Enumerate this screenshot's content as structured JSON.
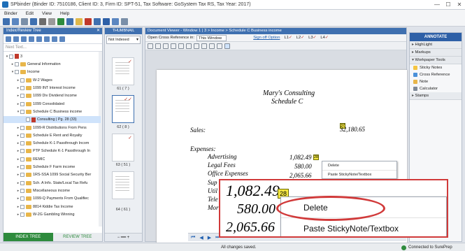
{
  "window": {
    "title": "SPbinder (Binder ID: 7510186, Client ID: 3, Firm ID: SPT-51, Tax Software: GoSystem Tax RS, Tax Year: 2017)",
    "controls": [
      "—",
      "☐",
      "✕"
    ]
  },
  "menu": [
    "Binder",
    "Edit",
    "View",
    "Help"
  ],
  "left_panel": {
    "header": "Index/Review Tree",
    "close": "✕",
    "search_placeholder": "Next Text...",
    "tree": [
      {
        "label": "3",
        "level": 0,
        "type": "doc",
        "exp": "▾"
      },
      {
        "label": "General Information",
        "level": 1,
        "type": "folder",
        "exp": "▸"
      },
      {
        "label": "Income",
        "level": 1,
        "type": "folder",
        "exp": "▾"
      },
      {
        "label": "W-2 Wages",
        "level": 2,
        "type": "folder",
        "exp": "▸"
      },
      {
        "label": "1099 INT Interest Income",
        "level": 2,
        "type": "folder",
        "exp": "▸"
      },
      {
        "label": "1099 Div Dividend Income",
        "level": 2,
        "type": "folder",
        "exp": "▸"
      },
      {
        "label": "1099 Consolidated",
        "level": 2,
        "type": "folder",
        "exp": "▸"
      },
      {
        "label": "Schedule C Business income",
        "level": 2,
        "type": "folder",
        "exp": "▾"
      },
      {
        "label": "Consulting | Pg. 28 (33)",
        "level": 3,
        "type": "doc",
        "exp": "",
        "selected": true
      },
      {
        "label": "1099-R  Distributions From Pens",
        "level": 2,
        "type": "folder",
        "exp": "▸"
      },
      {
        "label": "Schedule E  Rent and Royalty",
        "level": 2,
        "type": "folder",
        "exp": "▸"
      },
      {
        "label": "Schedule K-1 Passthrough Incom",
        "level": 2,
        "type": "folder",
        "exp": "▸"
      },
      {
        "label": "PTP Schedule K-1 Passthrough In",
        "level": 2,
        "type": "folder",
        "exp": "▸"
      },
      {
        "label": "REMIC",
        "level": 2,
        "type": "folder",
        "exp": "▸"
      },
      {
        "label": "Schedule F Farm income",
        "level": 2,
        "type": "folder",
        "exp": "▸"
      },
      {
        "label": "1RS-SSA 1099 Social Security Ber",
        "level": 2,
        "type": "folder",
        "exp": "▸"
      },
      {
        "label": "Sch. A Info. State/Local Tax Refu",
        "level": 2,
        "type": "folder",
        "exp": "▸"
      },
      {
        "label": "Miscellaneous income",
        "level": 2,
        "type": "folder",
        "exp": "▸"
      },
      {
        "label": "1099-Q Payments From Qualifiec",
        "level": 2,
        "type": "folder",
        "exp": "▸"
      },
      {
        "label": "8814 Kiddie Tax Income",
        "level": 2,
        "type": "folder",
        "exp": "▸"
      },
      {
        "label": "W-2G Gambling Winning",
        "level": 2,
        "type": "folder",
        "exp": "▸"
      }
    ],
    "tabs": [
      "INDEX TREE",
      "REVIEW TREE"
    ]
  },
  "thumbnails": {
    "tab": "THUMBNAIL",
    "filter": "Not Indexed",
    "pages": [
      {
        "caption": "61 ( 7 )",
        "check": "✓"
      },
      {
        "caption": "62 ( 8 )",
        "check": "✓✓"
      },
      {
        "caption": "63 ( 51 )",
        "check": "✓"
      },
      {
        "caption": "64 ( 61 )",
        "check": ""
      }
    ],
    "bottom": "− ━━ +"
  },
  "viewer": {
    "tab": "Document Viewer - Window 1 | 3 > Income > Schedule C Business income",
    "cross_ref_label": "Open Cross Reference in:",
    "cross_ref_value": "This Window",
    "signoff": "Sign off Option",
    "levels": [
      "L1",
      "L2",
      "L3",
      "L4"
    ],
    "page": {
      "title1": "Mary's Consulting",
      "title2": "Schedule C",
      "sales_label": "Sales:",
      "sales_value": "32,180.65",
      "sales_tag": "37",
      "expenses_label": "Expenses:",
      "expenses": [
        "Advertising",
        "Legal Fees",
        "Office Expenses",
        "Sup",
        "Util",
        "Tele",
        "Mor"
      ],
      "amounts": [
        "1,082.49",
        "580.00",
        "2,065.66"
      ],
      "amount_tag": "28"
    },
    "context_menu": [
      "Delete",
      "Paste StickyNote/Textbox"
    ],
    "nav": [
      "⏮",
      "◀",
      "▶",
      "⏭"
    ]
  },
  "right_panel": {
    "annotate": "ANNOTATE",
    "sections": [
      {
        "label": "HighLight",
        "open": false
      },
      {
        "label": "Markups",
        "open": false
      },
      {
        "label": "Workpaper Tools",
        "open": true
      }
    ],
    "tools": [
      {
        "label": "Sticky Notes",
        "color": "#f5c542"
      },
      {
        "label": "Cross Reference",
        "color": "#4a90d9"
      },
      {
        "label": "Note",
        "color": "#e8b64a"
      },
      {
        "label": "Calculator",
        "color": "#7f8a97"
      }
    ],
    "stamps": "Stamps"
  },
  "zoom": {
    "amounts": [
      "1,082.49",
      "580.00",
      "2,065.66"
    ],
    "tag": "28",
    "menu": [
      "Delete",
      "Paste StickyNote/Textbox"
    ]
  },
  "status": {
    "message": "All changes saved.",
    "connection": "Connected to SurePrep"
  },
  "colors": {
    "accent": "#3f70b0",
    "tree_green": "#2e8b3d",
    "callout_red": "#d13a3a",
    "highlight": "#f5e842"
  }
}
